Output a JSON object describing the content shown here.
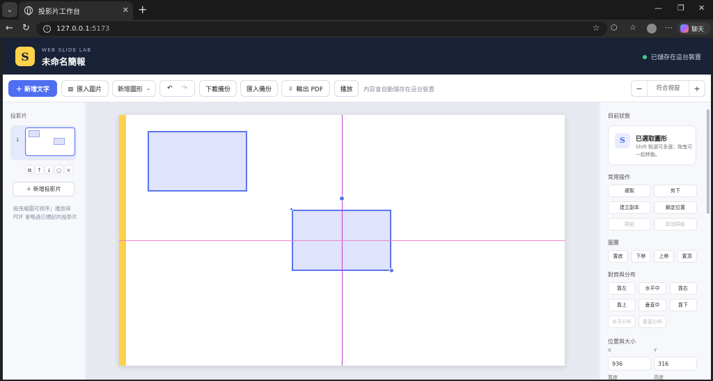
{
  "browser": {
    "tab_title": "投影片工作台",
    "url_host": "127.0.0.1",
    "url_port": ":5173",
    "copilot_label": "聊天"
  },
  "header": {
    "brand": "WEB SLIDE LAB",
    "doc_title": "未命名簡報",
    "saved_status": "已儲存在這台裝置"
  },
  "toolbar": {
    "add_text": "＋ 新增文字",
    "import_image": "匯入圖片",
    "add_shape": "新增圖形",
    "download_backup": "下載備份",
    "import_backup": "匯入備份",
    "export_pdf": "輸出 PDF",
    "play": "播放",
    "autosave_note": "內容會自動儲存在這台裝置",
    "zoom_label": "符合視窗"
  },
  "left_panel": {
    "title": "投影片",
    "slide_number": "1",
    "add_slide": "＋ 新增投影片",
    "hint": "拖曳縮圖可排序；播放與 PDF 會略過已標記的投影片"
  },
  "right_panel": {
    "current_status_title": "目前狀態",
    "status_heading": "已選取圖形",
    "status_desc": "Shift 點選可多選；拖曳可一起移動。",
    "common_title": "常用操作",
    "common": {
      "copy": "複製",
      "cut": "剪下",
      "duplicate": "建立副本",
      "lock": "鎖定位置",
      "group": "群組",
      "ungroup": "取消群組"
    },
    "layers_title": "圖層",
    "layers": {
      "to_back": "置底",
      "backward": "下移",
      "forward": "上移",
      "to_front": "置頂"
    },
    "align_title": "對齊與分布",
    "align": {
      "left": "靠左",
      "hcenter": "水平中",
      "right": "靠右",
      "top": "靠上",
      "vcenter": "垂直中",
      "bottom": "靠下",
      "hdist": "水平分布",
      "vdist": "垂直分布"
    },
    "position_title": "位置與大小",
    "x_label": "X",
    "y_label": "Y",
    "x_value": "936",
    "y_value": "316",
    "w_label": "寬度",
    "h_label": "高度"
  }
}
